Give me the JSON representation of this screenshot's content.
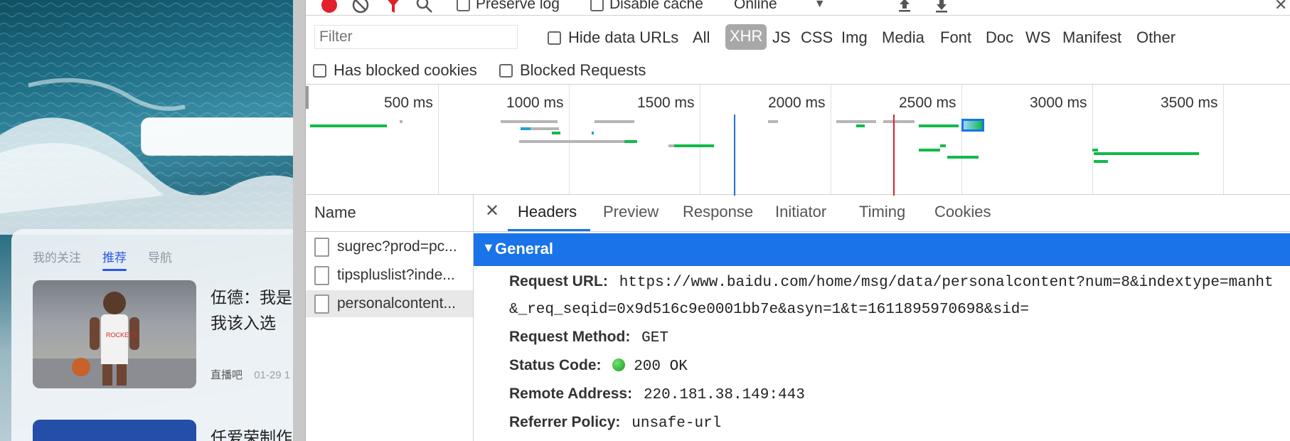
{
  "webpage": {
    "feed_tabs": [
      "我的关注",
      "推荐",
      "导航"
    ],
    "news": [
      {
        "title": "伍德：我是为我该入选",
        "source": "直播吧",
        "time": "01-29 1"
      },
      {
        "title": "任爱荣制作"
      }
    ]
  },
  "devtools": {
    "toolbar": {
      "preserve_log": "Preserve log",
      "disable_cache": "Disable cache",
      "throttling": "Online"
    },
    "filter": {
      "placeholder": "Filter",
      "hide_data_urls": "Hide data URLs",
      "types": [
        "All",
        "XHR",
        "JS",
        "CSS",
        "Img",
        "Media",
        "Font",
        "Doc",
        "WS",
        "Manifest",
        "Other"
      ],
      "active_type": "XHR"
    },
    "blocked": {
      "has_blocked_cookies": "Has blocked cookies",
      "blocked_requests": "Blocked Requests"
    },
    "timeline_ticks": [
      "500 ms",
      "1000 ms",
      "1500 ms",
      "2000 ms",
      "2500 ms",
      "3000 ms",
      "3500 ms"
    ],
    "requests": {
      "header": "Name",
      "items": [
        "sugrec?prod=pc...",
        "tipspluslist?inde...",
        "personalcontent..."
      ],
      "selected_index": 2
    },
    "details": {
      "tabs": [
        "Headers",
        "Preview",
        "Response",
        "Initiator",
        "Timing",
        "Cookies"
      ],
      "active_tab": "Headers",
      "section": "General",
      "request_url_label": "Request URL:",
      "request_url_line1": "https://www.baidu.com/home/msg/data/personalcontent?num=8&indextype=manht",
      "request_url_line2": "&_req_seqid=0x9d516c9e0001bb7e&asyn=1&t=1611895970698&sid=",
      "request_method_label": "Request Method:",
      "request_method": "GET",
      "status_code_label": "Status Code:",
      "status_code": "200 OK",
      "remote_address_label": "Remote Address:",
      "remote_address": "220.181.38.149:443",
      "referrer_policy_label": "Referrer Policy:",
      "referrer_policy": "unsafe-url"
    }
  },
  "colors": {
    "accent": "#1a73e8",
    "record": "#e0202a",
    "filter_icon": "#e0202a",
    "status_ok": "#1c9a1c",
    "active_filter_bg": "#a8a8a8"
  }
}
